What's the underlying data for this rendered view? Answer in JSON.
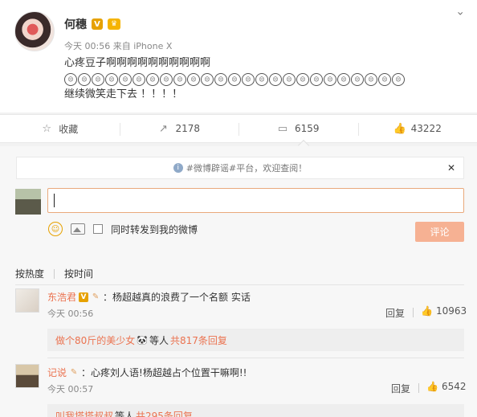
{
  "post": {
    "author": "何穗",
    "verified_badge": "V",
    "level_badge": "♛",
    "time": "今天 00:56",
    "source_prefix": "来自",
    "source": "iPhone X",
    "text_line1": "心疼豆子啊啊啊啊啊啊啊啊啊啊",
    "emoji_count_text": "☹",
    "text_line3": "继续微笑走下去 ！！！！"
  },
  "actions": {
    "favorite_label": "收藏",
    "forward_count": "2178",
    "comment_count": "6159",
    "like_count": "43222"
  },
  "comment_box": {
    "notice_text": "#微博辟谣#平台，欢迎查阅！",
    "input_value": "",
    "sync_label": "同时转发到我的微博",
    "submit_label": "评论"
  },
  "sort": {
    "by_hot": "按热度",
    "by_time": "按时间"
  },
  "comments": [
    {
      "user": "东浩君",
      "text": "：杨超越真的浪费了一个名额 实话",
      "time": "今天 00:56",
      "reply_label": "回复",
      "likes": "10963",
      "sub_user": "做个80斤的美少女",
      "sub_middle": "等人",
      "sub_link": "共817条回复"
    },
    {
      "user": "记说",
      "text": "：心疼刘人语!杨超越占个位置干嘛啊!!",
      "time": "今天 00:57",
      "reply_label": "回复",
      "likes": "6542",
      "sub_user": "叫我塔塔叔叔",
      "sub_middle": "等人",
      "sub_link": "共295条回复"
    }
  ],
  "colors": {
    "accent": "#eb7350",
    "submit_bg": "#f6b193",
    "verified": "#e6a100"
  },
  "icons": {
    "favorite": "star-icon",
    "forward": "share-icon",
    "comment": "comment-icon",
    "like": "thumbs-up-icon",
    "close": "close-icon",
    "more": "chevron-down-icon"
  }
}
